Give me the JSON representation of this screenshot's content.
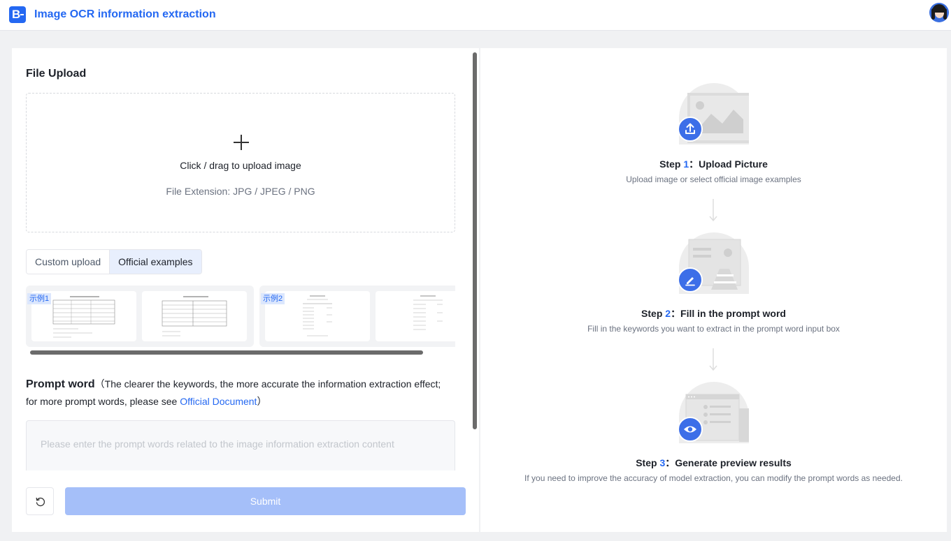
{
  "app": {
    "title": "Image OCR information extraction",
    "logo_letter": "B"
  },
  "upload": {
    "section_title": "File Upload",
    "main_text": "Click / drag to upload image",
    "extensions_text": "File Extension: JPG / JPEG / PNG"
  },
  "tabs": [
    {
      "label": "Custom upload",
      "active": false
    },
    {
      "label": "Official examples",
      "active": true
    }
  ],
  "examples": {
    "groups": [
      {
        "tag": "示例1"
      },
      {
        "tag": "示例2"
      }
    ]
  },
  "prompt": {
    "title": "Prompt word",
    "hint_before": "（The clearer the keywords, the more accurate the information extraction effect; for more prompt words, please see ",
    "link_text": "Official Document",
    "hint_after": "）",
    "placeholder": "Please enter the prompt words related to the image information extraction content"
  },
  "actions": {
    "submit_label": "Submit",
    "reset_icon": "refresh-icon"
  },
  "steps": [
    {
      "prefix": "Step ",
      "number": "1",
      "title": "：Upload Picture",
      "desc": "Upload image or select official image examples",
      "icon": "upload-icon"
    },
    {
      "prefix": "Step ",
      "number": "2",
      "title": "：Fill in the prompt word",
      "desc": "Fill in the keywords you want to extract in the prompt word input box",
      "icon": "edit-icon"
    },
    {
      "prefix": "Step ",
      "number": "3",
      "title": "：Generate preview results",
      "desc": "If you need to improve the accuracy of model extraction, you can modify the prompt words as needed.",
      "icon": "eye-icon"
    }
  ],
  "colors": {
    "brand": "#2468f2",
    "submit_disabled": "#a5bff9",
    "active_tab": "#e8effd"
  }
}
